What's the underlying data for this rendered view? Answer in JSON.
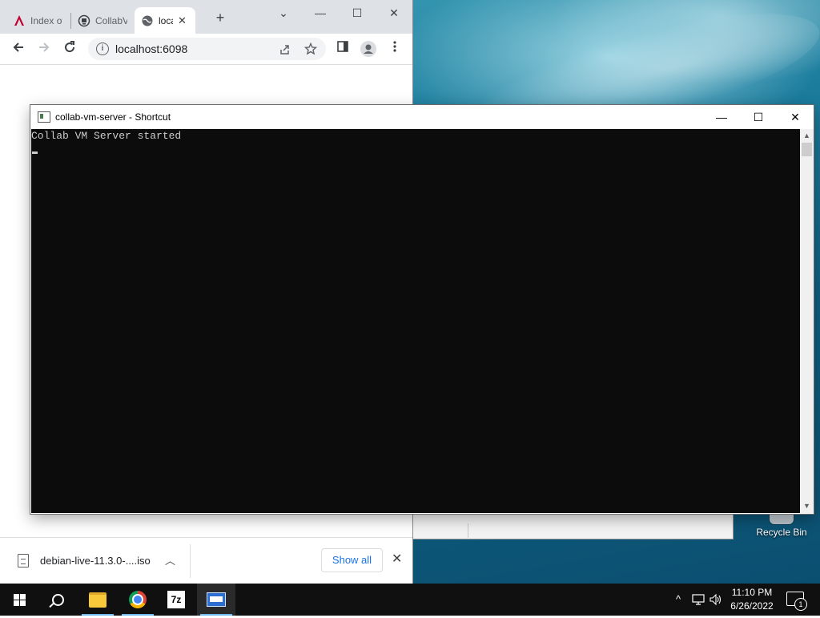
{
  "browser": {
    "tabs": [
      {
        "label": "Index of",
        "icon": "angular-icon",
        "active": false
      },
      {
        "label": "CollabVM",
        "icon": "collabvm-icon",
        "active": false
      },
      {
        "label": "localhost",
        "icon": "globe-icon",
        "active": true
      }
    ],
    "new_tab": "+",
    "address": "localhost:6098",
    "window_controls": {
      "tab_search": "⌄",
      "minimize": "—",
      "maximize": "☐",
      "close": "✕"
    },
    "download": {
      "filename": "debian-live-11.3.0-....iso",
      "show_all": "Show all"
    }
  },
  "console": {
    "title": "collab-vm-server - Shortcut",
    "output": "Collab VM Server started",
    "controls": {
      "minimize": "—",
      "maximize": "☐",
      "close": "✕"
    },
    "background": "#0c0c0c",
    "foreground": "#cccccc"
  },
  "desktop": {
    "recycle_bin_label": "Recycle Bin"
  },
  "taskbar": {
    "apps": [
      {
        "name": "start-button",
        "icon": "windows-icon"
      },
      {
        "name": "search-button",
        "icon": "search-icon"
      },
      {
        "name": "file-explorer",
        "icon": "folder-icon"
      },
      {
        "name": "chrome",
        "icon": "chrome-icon"
      },
      {
        "name": "7zip",
        "icon": "7zip-icon",
        "label": "7z"
      },
      {
        "name": "console",
        "icon": "console-icon"
      }
    ],
    "time": "11:10 PM",
    "date": "6/26/2022",
    "notifications_count": "1"
  }
}
